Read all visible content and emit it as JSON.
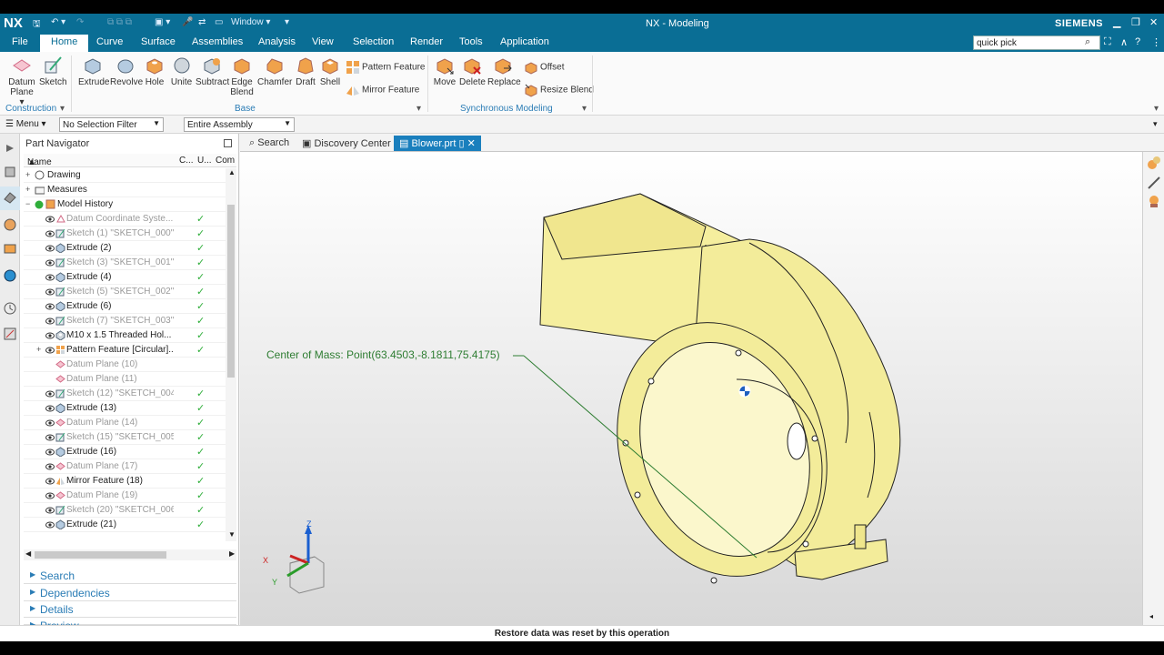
{
  "titlebar": {
    "logo": "NX",
    "window_menu": "Window",
    "window_title": "NX - Modeling",
    "brand": "SIEMENS"
  },
  "menubar": {
    "items": [
      "File",
      "Home",
      "Curve",
      "Surface",
      "Assemblies",
      "Analysis",
      "View",
      "Selection",
      "Render",
      "Tools",
      "Application"
    ],
    "search_value": "quick  pick"
  },
  "ribbon": {
    "construction": {
      "datum_plane": "Datum",
      "datum_plane2": "Plane",
      "sketch": "Sketch",
      "group_label": "Construction"
    },
    "base": {
      "extrude": "Extrude",
      "revolve": "Revolve",
      "hole": "Hole",
      "unite": "Unite",
      "subtract": "Subtract",
      "edge_blend": "Edge",
      "edge_blend2": "Blend",
      "chamfer": "Chamfer",
      "draft": "Draft",
      "shell": "Shell",
      "pattern_feature": "Pattern Feature",
      "mirror_feature": "Mirror Feature",
      "group_label": "Base"
    },
    "sync": {
      "move": "Move",
      "delete": "Delete",
      "replace": "Replace",
      "offset": "Offset",
      "resize_blend": "Resize Blend",
      "group_label": "Synchronous Modeling"
    }
  },
  "selbar": {
    "menu": "Menu",
    "filter": "No Selection Filter",
    "scope": "Entire Assembly"
  },
  "navigator": {
    "title": "Part Navigator",
    "col_name": "Name",
    "col_c": "C...",
    "col_u": "U...",
    "col_com": "Com",
    "rows": [
      {
        "name": "Drawing",
        "check": ""
      },
      {
        "name": "Measures",
        "check": ""
      },
      {
        "name": "Model History",
        "check": ""
      },
      {
        "name": "Datum Coordinate Syste...",
        "check": "✓"
      },
      {
        "name": "Sketch (1) \"SKETCH_000\"",
        "check": "✓"
      },
      {
        "name": "Extrude (2)",
        "check": "✓"
      },
      {
        "name": "Sketch (3) \"SKETCH_001\"",
        "check": "✓"
      },
      {
        "name": "Extrude (4)",
        "check": "✓"
      },
      {
        "name": "Sketch (5) \"SKETCH_002\"",
        "check": "✓"
      },
      {
        "name": "Extrude (6)",
        "check": "✓"
      },
      {
        "name": "Sketch (7) \"SKETCH_003\"",
        "check": "✓"
      },
      {
        "name": "M10 x 1.5 Threaded Hol...",
        "check": "✓"
      },
      {
        "name": "Pattern Feature [Circular]...",
        "check": "✓"
      },
      {
        "name": "Datum Plane (10)",
        "check": ""
      },
      {
        "name": "Datum Plane (11)",
        "check": ""
      },
      {
        "name": "Sketch (12) \"SKETCH_004\"",
        "check": "✓"
      },
      {
        "name": "Extrude (13)",
        "check": "✓"
      },
      {
        "name": "Datum Plane (14)",
        "check": "✓"
      },
      {
        "name": "Sketch (15) \"SKETCH_005\"",
        "check": "✓"
      },
      {
        "name": "Extrude (16)",
        "check": "✓"
      },
      {
        "name": "Datum Plane (17)",
        "check": "✓"
      },
      {
        "name": "Mirror Feature (18)",
        "check": "✓"
      },
      {
        "name": "Datum Plane (19)",
        "check": "✓"
      },
      {
        "name": "Sketch (20) \"SKETCH_006\"",
        "check": "✓"
      },
      {
        "name": "Extrude (21)",
        "check": "✓"
      }
    ],
    "panels": [
      "Search",
      "Dependencies",
      "Details",
      "Preview"
    ]
  },
  "tabs": [
    "Search",
    "Discovery Center",
    "Blower.prt"
  ],
  "viewport": {
    "center_of_mass_label": "Center of Mass: Point(63.4503,-8.1811,75.4175)",
    "axis_z": "Z",
    "axis_x": "X",
    "axis_y": "Y"
  },
  "status": "Restore data was reset by this operation",
  "colors": {
    "accent": "#0a6e95",
    "model": "#f3ec9a",
    "annotation": "#2e7d32"
  }
}
